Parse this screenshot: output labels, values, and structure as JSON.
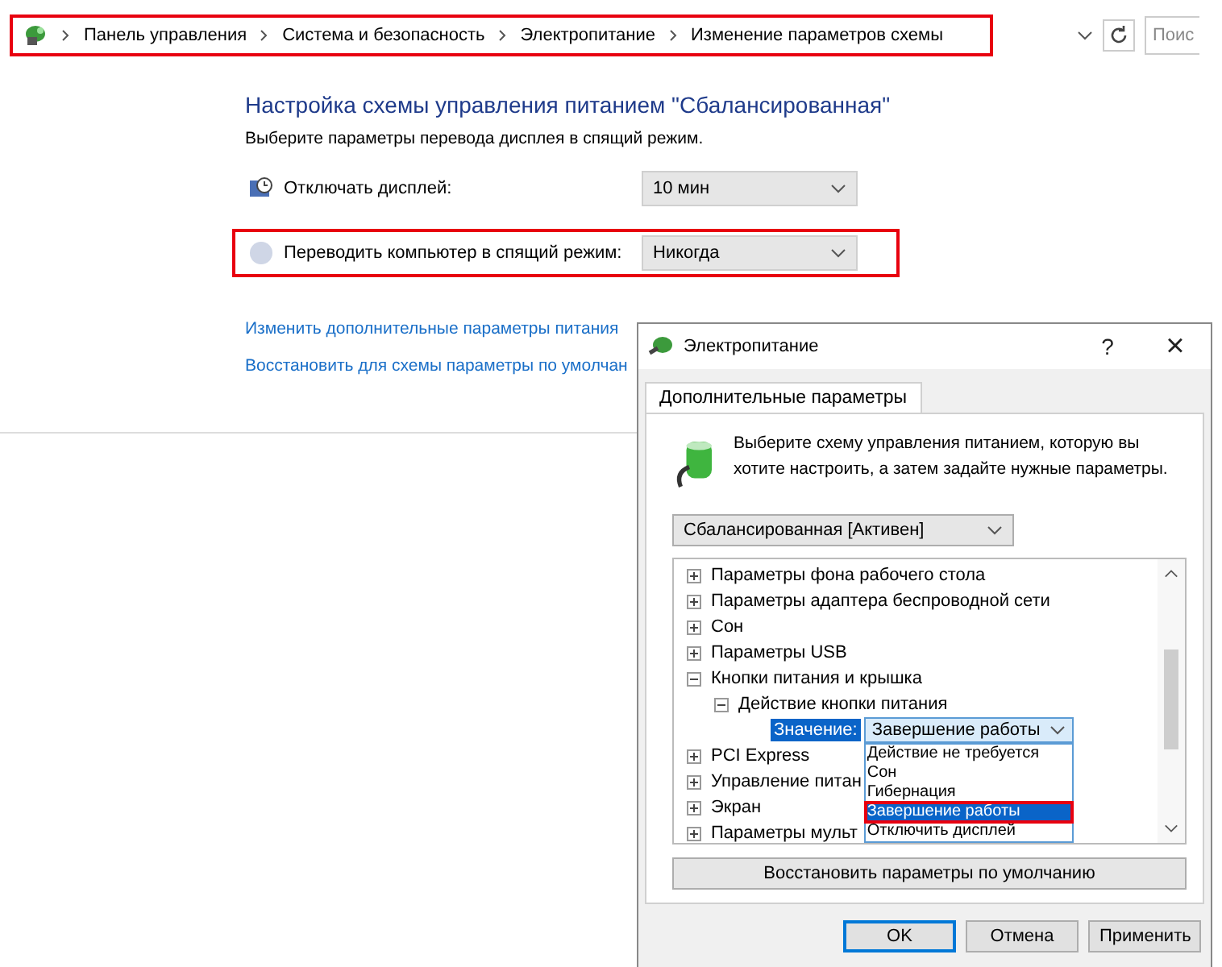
{
  "address_bar": {
    "breadcrumbs": [
      "Панель управления",
      "Система и безопасность",
      "Электропитание",
      "Изменение параметров схемы"
    ],
    "highlighted": true,
    "search_placeholder": "Поис"
  },
  "plan": {
    "title": "Настройка схемы управления питанием \"Сбалансированная\"",
    "subtitle": "Выберите параметры перевода дисплея в спящий режим.",
    "settings": [
      {
        "kind": "display",
        "label": "Отключать дисплей:",
        "value": "10 мин",
        "highlighted": false
      },
      {
        "kind": "sleep",
        "label": "Переводить компьютер в спящий режим:",
        "value": "Никогда",
        "highlighted": true
      }
    ],
    "links": [
      "Изменить дополнительные параметры питания",
      "Восстановить для схемы параметры по умолчан"
    ]
  },
  "dialog": {
    "title": "Электропитание",
    "help": "?",
    "close": "×",
    "tabs": [
      {
        "label": "Дополнительные параметры",
        "selected": true
      }
    ],
    "intro": "Выберите схему управления питанием, которую вы хотите настроить, а затем задайте нужные параметры.",
    "scheme": "Сбалансированная [Активен]",
    "tree": [
      {
        "label": "Параметры фона рабочего стола",
        "expanded": false
      },
      {
        "label": "Параметры адаптера беспроводной сети",
        "expanded": false
      },
      {
        "label": "Сон",
        "expanded": false
      },
      {
        "label": "Параметры USB",
        "expanded": false
      },
      {
        "label": "Кнопки питания и крышка",
        "expanded": true,
        "children": [
          {
            "label": "Действие кнопки питания",
            "expanded": true,
            "setting": {
              "label": "Значение:",
              "value": "Завершение работы",
              "open": true,
              "options": [
                {
                  "label": "Действие не требуется",
                  "selected": false,
                  "highlighted": false
                },
                {
                  "label": "Сон",
                  "selected": false,
                  "highlighted": false
                },
                {
                  "label": "Гибернация",
                  "selected": false,
                  "highlighted": false
                },
                {
                  "label": "Завершение работы",
                  "selected": true,
                  "highlighted": true
                },
                {
                  "label": "Отключить дисплей",
                  "selected": false,
                  "highlighted": false
                }
              ]
            }
          }
        ]
      },
      {
        "label": "PCI Express",
        "expanded": false
      },
      {
        "label": "Управление питан",
        "expanded": false
      },
      {
        "label": "Экран",
        "expanded": false
      },
      {
        "label": "Параметры мульт",
        "expanded": false
      }
    ],
    "restore_button": "Восстановить параметры по умолчанию",
    "buttons": [
      {
        "label": "OK",
        "default": true
      },
      {
        "label": "Отмена",
        "default": false
      },
      {
        "label": "Применить",
        "default": false
      }
    ]
  }
}
